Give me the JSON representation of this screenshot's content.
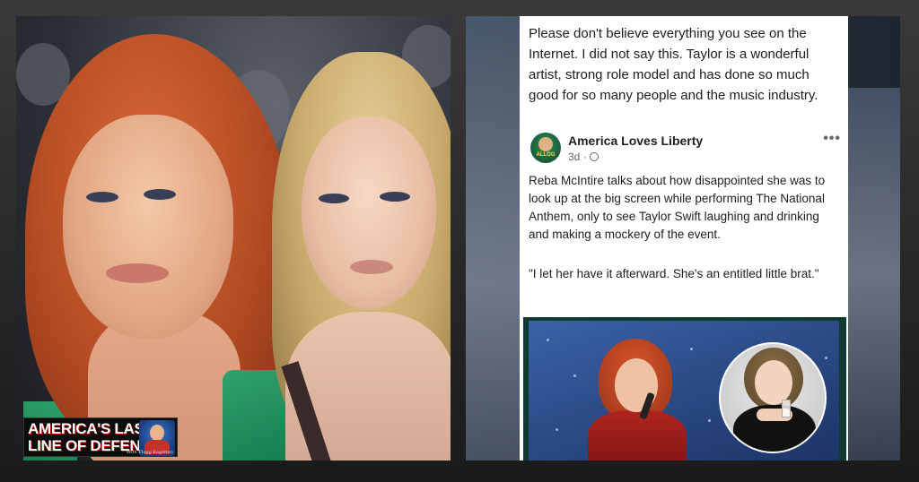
{
  "logo": {
    "line1": "AMERICA'S LAST",
    "line2": "LINE OF DEFENSE",
    "tagline": "With Flagg Eagleton"
  },
  "post": {
    "quote": "Please don't believe everything you see on the Internet. I did not say this. Taylor is a wonderful artist, strong role model and has done so much good for so many people and the music industry.",
    "author": "America Loves Liberty",
    "avatar_text": "ALLOG",
    "time": "3d ·",
    "privacy_icon": "globe-icon",
    "more_icon": "ellipsis-icon",
    "more_glyph": "•••",
    "body": "Reba McIntire talks about how disappointed she was to look up at the big screen while performing The National Anthem, only to see Taylor Swift laughing and drinking and making a mockery of the event.",
    "quote2": "\"I let her have it afterward. She's an entitled little brat.\""
  }
}
